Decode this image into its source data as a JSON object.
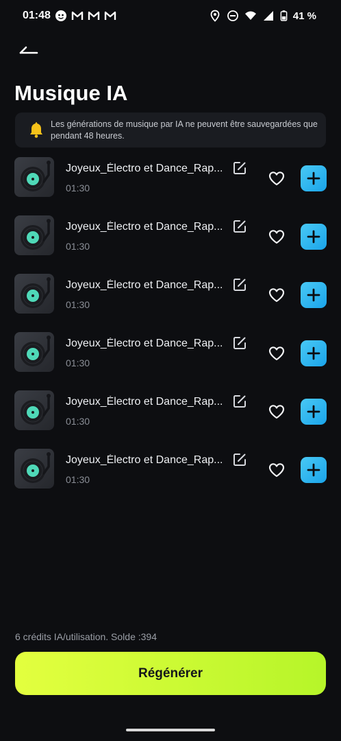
{
  "status_bar": {
    "time": "01:48",
    "battery_text": "41 %",
    "left_icons": [
      "app-icon",
      "gmail-icon",
      "gmail-icon",
      "gmail-icon"
    ],
    "right_icons": [
      "location-icon",
      "do-not-disturb-icon",
      "wifi-icon",
      "signal-icon",
      "battery-icon"
    ]
  },
  "header": {
    "title": "Musique IA",
    "back_icon": "back-arrow-icon"
  },
  "notice": {
    "icon": "bell-icon",
    "text": "Les générations de musique par IA ne peuvent être sauvegardées que pendant 48 heures."
  },
  "tracks": [
    {
      "title": "Joyeux_Électro et Dance_Rap...",
      "duration": "01:30"
    },
    {
      "title": "Joyeux_Électro et Dance_Rap...",
      "duration": "01:30"
    },
    {
      "title": "Joyeux_Électro et Dance_Rap...",
      "duration": "01:30"
    },
    {
      "title": "Joyeux_Électro et Dance_Rap...",
      "duration": "01:30"
    },
    {
      "title": "Joyeux_Électro et Dance_Rap...",
      "duration": "01:30"
    },
    {
      "title": "Joyeux_Électro et Dance_Rap...",
      "duration": "01:30"
    }
  ],
  "footer": {
    "credits": "6 crédits IA/utilisation. Solde :394",
    "regenerate_label": "Régénérer"
  },
  "colors": {
    "background": "#0d0e11",
    "accent_blue": "#1aa4ea",
    "accent_green": "#d2fb35",
    "record_teal": "#4fd9b8"
  }
}
